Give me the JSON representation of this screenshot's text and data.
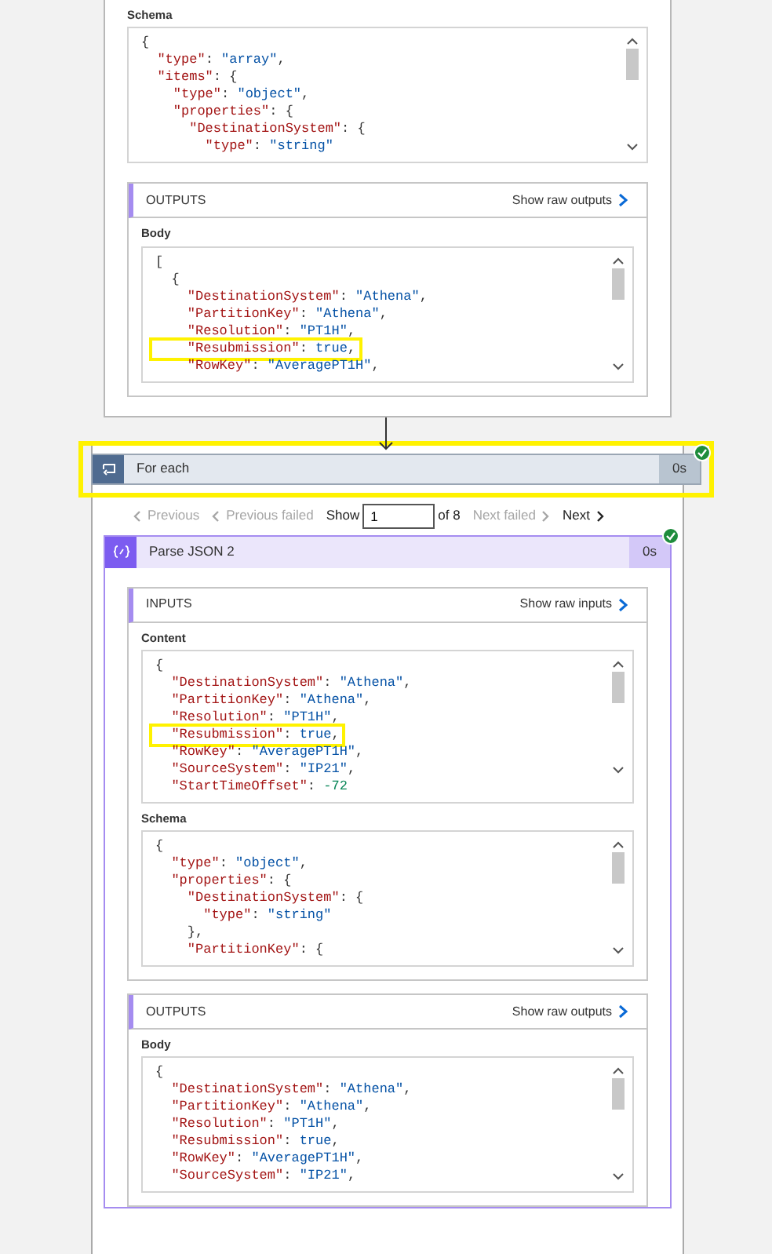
{
  "top_card": {
    "schema": {
      "label": "Schema",
      "lines": [
        [
          {
            "text": "{",
            "kind": "punct"
          }
        ],
        [
          {
            "text": "  \"type\"",
            "kind": "key"
          },
          {
            "text": ": ",
            "kind": "punct"
          },
          {
            "text": "\"array\"",
            "kind": "string"
          },
          {
            "text": ",",
            "kind": "punct"
          }
        ],
        [
          {
            "text": "  \"items\"",
            "kind": "key"
          },
          {
            "text": ": {",
            "kind": "punct"
          }
        ],
        [
          {
            "text": "    \"type\"",
            "kind": "key"
          },
          {
            "text": ": ",
            "kind": "punct"
          },
          {
            "text": "\"object\"",
            "kind": "string"
          },
          {
            "text": ",",
            "kind": "punct"
          }
        ],
        [
          {
            "text": "    \"properties\"",
            "kind": "key"
          },
          {
            "text": ": {",
            "kind": "punct"
          }
        ],
        [
          {
            "text": "      \"DestinationSystem\"",
            "kind": "key"
          },
          {
            "text": ": {",
            "kind": "punct"
          }
        ],
        [
          {
            "text": "        \"type\"",
            "kind": "key"
          },
          {
            "text": ": ",
            "kind": "punct"
          },
          {
            "text": "\"string\"",
            "kind": "string"
          }
        ]
      ],
      "highlighted": [
        false,
        false,
        false,
        false,
        false,
        false,
        false
      ]
    },
    "outputs": {
      "title": "OUTPUTS",
      "link": "Show raw outputs",
      "blocks": [
        {
          "label": "Body",
          "lines": [
            [
              {
                "text": "[",
                "kind": "punct"
              }
            ],
            [
              {
                "text": "  {",
                "kind": "punct"
              }
            ],
            [
              {
                "text": "    \"DestinationSystem\"",
                "kind": "key"
              },
              {
                "text": ": ",
                "kind": "punct"
              },
              {
                "text": "\"Athena\"",
                "kind": "string"
              },
              {
                "text": ",",
                "kind": "punct"
              }
            ],
            [
              {
                "text": "    \"PartitionKey\"",
                "kind": "key"
              },
              {
                "text": ": ",
                "kind": "punct"
              },
              {
                "text": "\"Athena\"",
                "kind": "string"
              },
              {
                "text": ",",
                "kind": "punct"
              }
            ],
            [
              {
                "text": "    \"Resolution\"",
                "kind": "key"
              },
              {
                "text": ": ",
                "kind": "punct"
              },
              {
                "text": "\"PT1H\"",
                "kind": "string"
              },
              {
                "text": ",",
                "kind": "punct"
              }
            ],
            [
              {
                "text": "    \"Resubmission\"",
                "kind": "key"
              },
              {
                "text": ": ",
                "kind": "punct"
              },
              {
                "text": "true",
                "kind": "literal"
              },
              {
                "text": ",",
                "kind": "punct"
              }
            ],
            [
              {
                "text": "    \"RowKey\"",
                "kind": "key"
              },
              {
                "text": ": ",
                "kind": "punct"
              },
              {
                "text": "\"AveragePT1H\"",
                "kind": "string"
              },
              {
                "text": ",",
                "kind": "punct"
              }
            ]
          ],
          "highlighted": [
            false,
            false,
            false,
            false,
            false,
            true,
            false
          ]
        }
      ]
    }
  },
  "for_each": {
    "title": "For each",
    "duration": "0s",
    "succeeded": true,
    "highlighted": true
  },
  "pagination": {
    "items": [
      {
        "label": "Previous",
        "kind": "back",
        "disabled": true
      },
      {
        "label": "Previous failed",
        "kind": "back",
        "disabled": true
      }
    ],
    "show_label": "Show",
    "page_value": "1",
    "of_label": "of 8",
    "next_items": [
      {
        "label": "Next failed",
        "kind": "forward",
        "disabled": true
      },
      {
        "label": "Next",
        "kind": "forward",
        "disabled": false
      }
    ]
  },
  "parse_json": {
    "title": "Parse JSON 2",
    "duration": "0s",
    "succeeded": true,
    "inputs": {
      "title": "INPUTS",
      "link": "Show raw inputs",
      "blocks": [
        {
          "label": "Content",
          "lines": [
            [
              {
                "text": "{",
                "kind": "punct"
              }
            ],
            [
              {
                "text": "  \"DestinationSystem\"",
                "kind": "key"
              },
              {
                "text": ": ",
                "kind": "punct"
              },
              {
                "text": "\"Athena\"",
                "kind": "string"
              },
              {
                "text": ",",
                "kind": "punct"
              }
            ],
            [
              {
                "text": "  \"PartitionKey\"",
                "kind": "key"
              },
              {
                "text": ": ",
                "kind": "punct"
              },
              {
                "text": "\"Athena\"",
                "kind": "string"
              },
              {
                "text": ",",
                "kind": "punct"
              }
            ],
            [
              {
                "text": "  \"Resolution\"",
                "kind": "key"
              },
              {
                "text": ": ",
                "kind": "punct"
              },
              {
                "text": "\"PT1H\"",
                "kind": "string"
              },
              {
                "text": ",",
                "kind": "punct"
              }
            ],
            [
              {
                "text": "  \"Resubmission\"",
                "kind": "key"
              },
              {
                "text": ": ",
                "kind": "punct"
              },
              {
                "text": "true",
                "kind": "literal"
              },
              {
                "text": ",",
                "kind": "punct"
              }
            ],
            [
              {
                "text": "  \"RowKey\"",
                "kind": "key"
              },
              {
                "text": ": ",
                "kind": "punct"
              },
              {
                "text": "\"AveragePT1H\"",
                "kind": "string"
              },
              {
                "text": ",",
                "kind": "punct"
              }
            ],
            [
              {
                "text": "  \"SourceSystem\"",
                "kind": "key"
              },
              {
                "text": ": ",
                "kind": "punct"
              },
              {
                "text": "\"IP21\"",
                "kind": "string"
              },
              {
                "text": ",",
                "kind": "punct"
              }
            ],
            [
              {
                "text": "  \"StartTimeOffset\"",
                "kind": "key"
              },
              {
                "text": ": ",
                "kind": "punct"
              },
              {
                "text": "-72",
                "kind": "number"
              }
            ]
          ],
          "highlighted": [
            false,
            false,
            false,
            false,
            true,
            false,
            false,
            false
          ]
        },
        {
          "label": "Schema",
          "lines": [
            [
              {
                "text": "{",
                "kind": "punct"
              }
            ],
            [
              {
                "text": "  \"type\"",
                "kind": "key"
              },
              {
                "text": ": ",
                "kind": "punct"
              },
              {
                "text": "\"object\"",
                "kind": "string"
              },
              {
                "text": ",",
                "kind": "punct"
              }
            ],
            [
              {
                "text": "  \"properties\"",
                "kind": "key"
              },
              {
                "text": ": {",
                "kind": "punct"
              }
            ],
            [
              {
                "text": "    \"DestinationSystem\"",
                "kind": "key"
              },
              {
                "text": ": {",
                "kind": "punct"
              }
            ],
            [
              {
                "text": "      \"type\"",
                "kind": "key"
              },
              {
                "text": ": ",
                "kind": "punct"
              },
              {
                "text": "\"string\"",
                "kind": "string"
              }
            ],
            [
              {
                "text": "    },",
                "kind": "punct"
              }
            ],
            [
              {
                "text": "    \"PartitionKey\"",
                "kind": "key"
              },
              {
                "text": ": {",
                "kind": "punct"
              }
            ]
          ],
          "highlighted": [
            false,
            false,
            false,
            false,
            false,
            false,
            false
          ]
        }
      ]
    },
    "outputs": {
      "title": "OUTPUTS",
      "link": "Show raw outputs",
      "blocks": [
        {
          "label": "Body",
          "lines": [
            [
              {
                "text": "{",
                "kind": "punct"
              }
            ],
            [
              {
                "text": "  \"DestinationSystem\"",
                "kind": "key"
              },
              {
                "text": ": ",
                "kind": "punct"
              },
              {
                "text": "\"Athena\"",
                "kind": "string"
              },
              {
                "text": ",",
                "kind": "punct"
              }
            ],
            [
              {
                "text": "  \"PartitionKey\"",
                "kind": "key"
              },
              {
                "text": ": ",
                "kind": "punct"
              },
              {
                "text": "\"Athena\"",
                "kind": "string"
              },
              {
                "text": ",",
                "kind": "punct"
              }
            ],
            [
              {
                "text": "  \"Resolution\"",
                "kind": "key"
              },
              {
                "text": ": ",
                "kind": "punct"
              },
              {
                "text": "\"PT1H\"",
                "kind": "string"
              },
              {
                "text": ",",
                "kind": "punct"
              }
            ],
            [
              {
                "text": "  \"Resubmission\"",
                "kind": "key"
              },
              {
                "text": ": ",
                "kind": "punct"
              },
              {
                "text": "true",
                "kind": "literal"
              },
              {
                "text": ",",
                "kind": "punct"
              }
            ],
            [
              {
                "text": "  \"RowKey\"",
                "kind": "key"
              },
              {
                "text": ": ",
                "kind": "punct"
              },
              {
                "text": "\"AveragePT1H\"",
                "kind": "string"
              },
              {
                "text": ",",
                "kind": "punct"
              }
            ],
            [
              {
                "text": "  \"SourceSystem\"",
                "kind": "key"
              },
              {
                "text": ": ",
                "kind": "punct"
              },
              {
                "text": "\"IP21\"",
                "kind": "string"
              },
              {
                "text": ",",
                "kind": "punct"
              }
            ]
          ],
          "highlighted": [
            false,
            false,
            false,
            false,
            false,
            false,
            false
          ]
        }
      ]
    }
  }
}
